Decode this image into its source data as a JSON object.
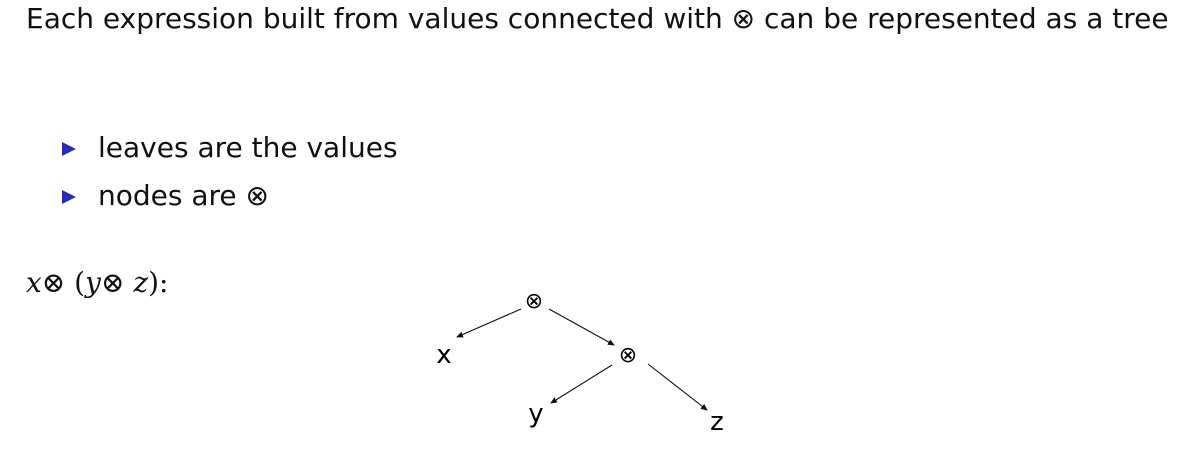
{
  "intro_text": "Each expression built from values connected with ⊗ can be represented as a tree",
  "bullets": [
    {
      "text": "leaves are the values"
    },
    {
      "text": "nodes are ⊗"
    }
  ],
  "expression": {
    "x": "x",
    "op1": "⊗",
    "open_paren": "(",
    "y": "y",
    "op2": "⊗",
    "z": "z",
    "close_paren": ")",
    "colon": ":"
  },
  "tree": {
    "root": {
      "label": "⊗"
    },
    "inner": {
      "label": "⊗"
    },
    "leaves": [
      {
        "label": "x"
      },
      {
        "label": "y"
      },
      {
        "label": "z"
      }
    ]
  }
}
